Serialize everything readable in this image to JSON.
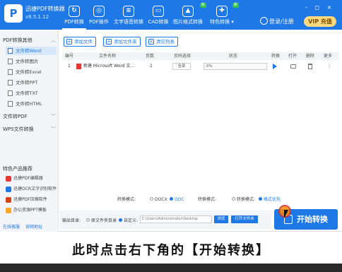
{
  "app": {
    "name": "迅捷PDF转换器",
    "version": "v8.5.1.12"
  },
  "nav_tabs": [
    {
      "label": "PDF转换",
      "icon": "refresh-icon",
      "active": true
    },
    {
      "label": "PDF操作",
      "icon": "settings-icon",
      "active": false
    },
    {
      "label": "文字语音转换",
      "icon": "audio-icon",
      "active": false
    },
    {
      "label": "CAD转换",
      "icon": "cad-icon",
      "active": false
    },
    {
      "label": "图片格式转换",
      "icon": "image-icon",
      "active": false,
      "badge": "新"
    },
    {
      "label": "特色转换",
      "icon": "gift-icon",
      "active": false,
      "badge": "新"
    }
  ],
  "header": {
    "login": "登录/注册",
    "vip": "VIP 充值",
    "window_controls": "- ◻ ×"
  },
  "sidebar": {
    "section1": "PDF转换其他",
    "items": [
      {
        "label": "文件转Word",
        "active": true
      },
      {
        "label": "文件转图片",
        "active": false
      },
      {
        "label": "文件转Excel",
        "active": false
      },
      {
        "label": "文件转PPT",
        "active": false
      },
      {
        "label": "文件转TXT",
        "active": false
      },
      {
        "label": "文件转HTML",
        "active": false
      }
    ],
    "section2": "文件转PDF",
    "section3": "WPS文件转换",
    "products_title": "特色产品推荐",
    "products": [
      {
        "label": "迅捷PDF编辑器",
        "color": "#e53935"
      },
      {
        "label": "迅捷OCR文字识别软件",
        "color": "#1e78e6"
      },
      {
        "label": "迅捷PDF压缩软件",
        "color": "#d84315"
      },
      {
        "label": "办公资源PPT模板",
        "color": "#f9a825"
      }
    ],
    "footer_service": "在线客服",
    "footer_website": "官网地址"
  },
  "toolbar": {
    "add_file": "添加文件",
    "add_folder": "添加文件夹",
    "clear_list": "清空列表"
  },
  "table": {
    "headers": [
      "编号",
      "文件名称",
      "页数",
      "页码选择",
      "状态",
      "转换",
      "打开",
      "删除",
      "更多"
    ],
    "rows": [
      {
        "index": "1",
        "name": "新建 Microsoft Word 文...",
        "pages": "1",
        "range": "全部",
        "progress": 0,
        "progress_label": "0%"
      }
    ]
  },
  "format": {
    "mode_label": "转换模式:",
    "docx": "DOCX",
    "doc": "DOC",
    "selected_format": "DOC",
    "text_priority": "转换模式:",
    "layout_priority": "格式优先",
    "layout_label": "转换模式:"
  },
  "output": {
    "label": "输出目录:",
    "original": "原文件夹目录",
    "custom": "自定义:",
    "path": "C:\\Users\\Administrator\\Desktop",
    "browse": "浏览",
    "open_folder": "打开文件夹"
  },
  "start_button": "开始转换",
  "caption": "此时点击右下角的【开始转换】",
  "colors": {
    "brand": "#1e78e6",
    "vip": "#ffd980"
  }
}
